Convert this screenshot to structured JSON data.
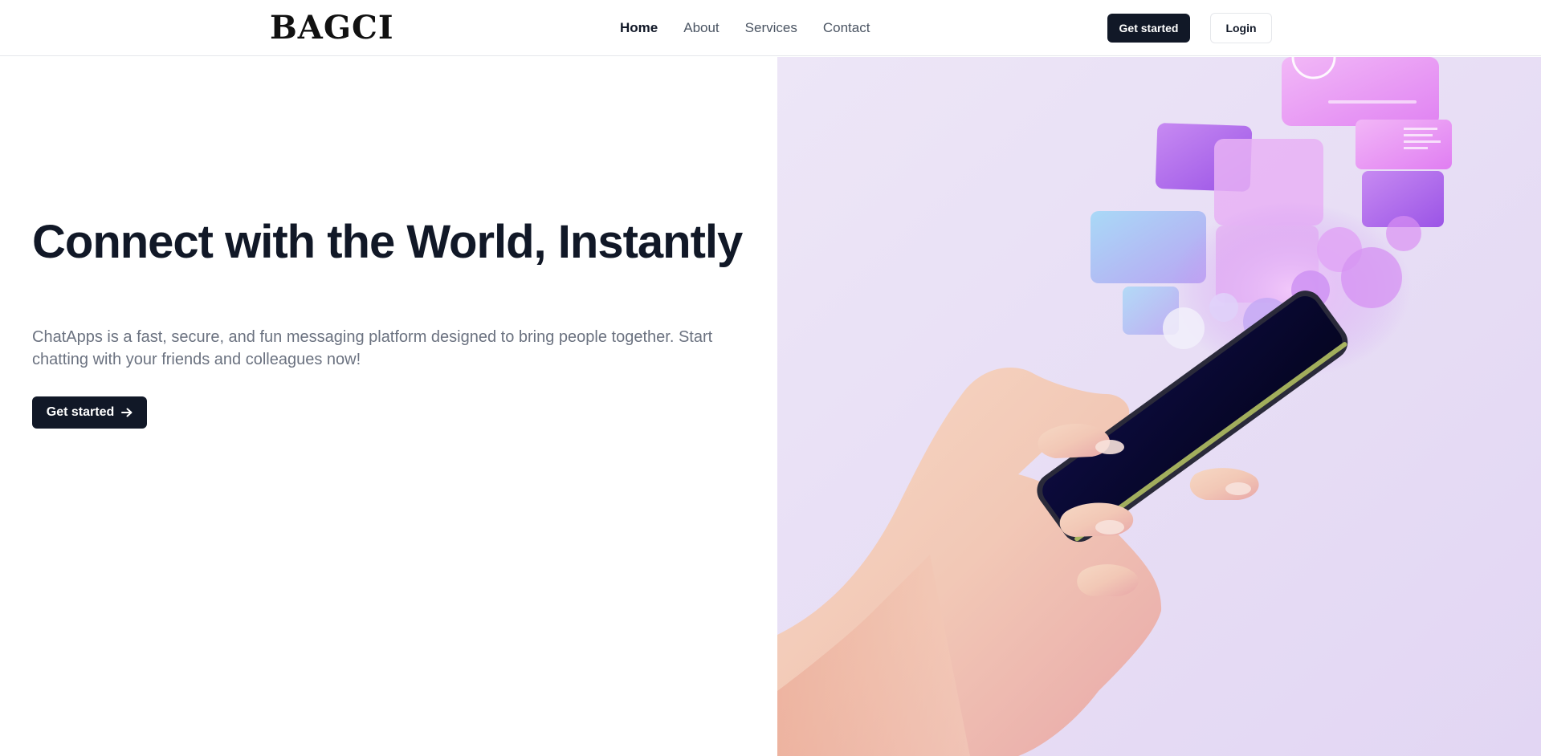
{
  "brand": {
    "logo_text": "BAGCI"
  },
  "nav": {
    "links": [
      {
        "label": "Home",
        "active": true
      },
      {
        "label": "About",
        "active": false
      },
      {
        "label": "Services",
        "active": false
      },
      {
        "label": "Contact",
        "active": false
      }
    ],
    "get_started_label": "Get started",
    "login_label": "Login"
  },
  "hero": {
    "title": "Connect with the World, Instantly",
    "subtitle": "ChatApps is a fast, secure, and fun messaging platform designed to bring people together. Start chatting with your friends and colleagues now!",
    "cta_label": "Get started",
    "cta_icon": "arrow-right-icon",
    "image_description_icon": "hand-holding-phone-illustration"
  },
  "colors": {
    "primary_dark": "#111827",
    "text_muted": "#6b7280",
    "hero_bg": "#e8dff5",
    "accent_purple": "#b565f0",
    "accent_pink": "#e98ff5"
  }
}
